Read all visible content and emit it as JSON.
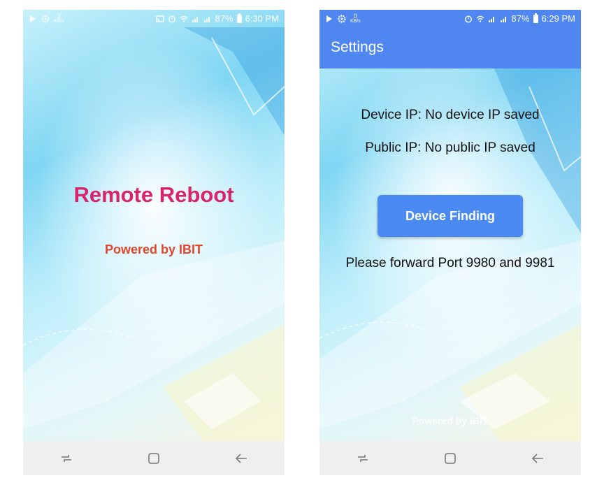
{
  "left_screen": {
    "statusbar": {
      "speed_value": "2",
      "speed_unit": "KB/s",
      "battery_pct": "87%",
      "time": "6:30 PM"
    },
    "title": "Remote Reboot",
    "powered_by": "Powered by IBIT"
  },
  "right_screen": {
    "statusbar": {
      "speed_value": "0",
      "speed_unit": "KB/s",
      "battery_pct": "87%",
      "time": "6:29 PM"
    },
    "appbar_title": "Settings",
    "device_ip": "Device IP: No device IP saved",
    "public_ip": "Public IP: No public IP saved",
    "device_finding_label": "Device Finding",
    "port_note": "Please forward Port 9980 and 9981",
    "powered_by": "Powered by IBIT"
  },
  "colors": {
    "title": "#d8246a",
    "powered_by": "#e0462b",
    "appbar": "#4f86f0",
    "button": "#4a8af2",
    "navbar": "#efefef"
  },
  "icons": [
    "play-store-icon",
    "settings-gear-icon",
    "cast-icon",
    "alarm-icon",
    "wifi-icon",
    "signal-icon",
    "battery-icon",
    "recent-apps-icon",
    "home-icon",
    "back-icon"
  ]
}
